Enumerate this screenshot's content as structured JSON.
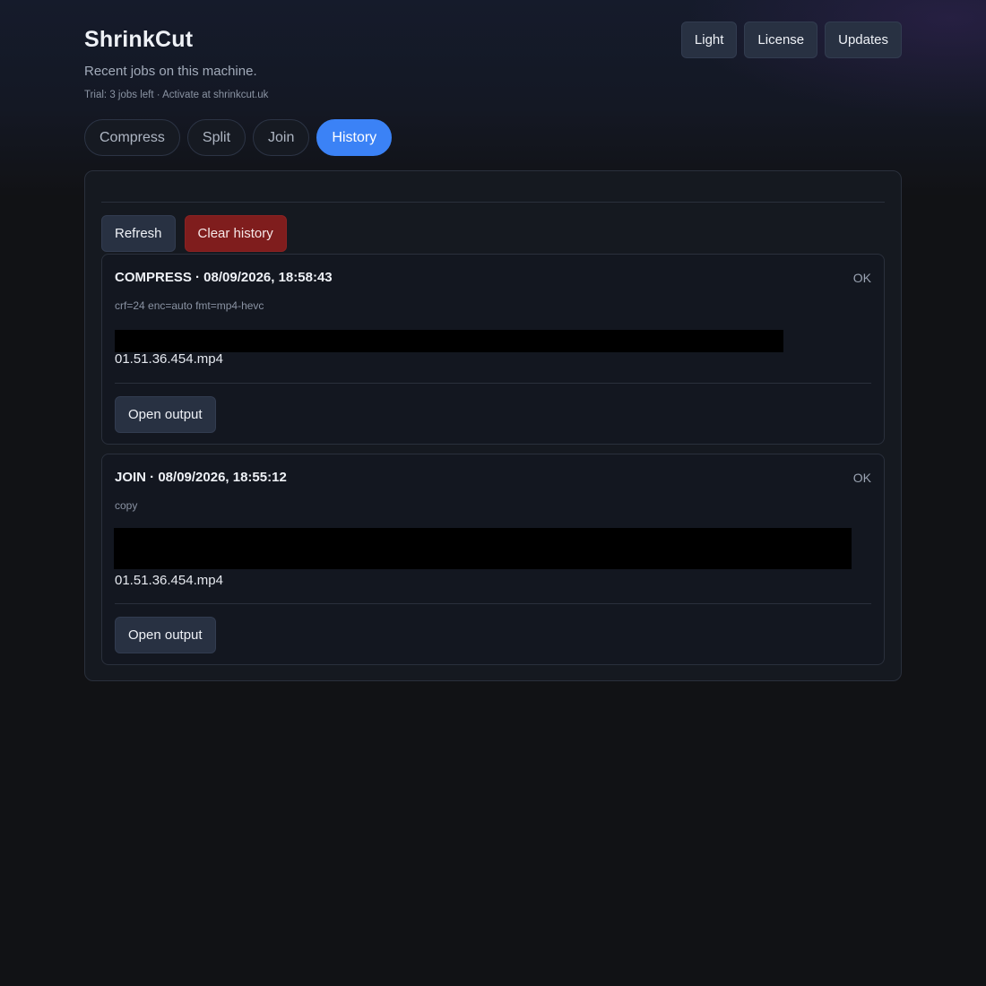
{
  "app": {
    "title": "ShrinkCut",
    "subtitle": "Recent jobs on this machine.",
    "trial": "Trial: 3 jobs left · Activate at shrinkcut.uk"
  },
  "top_actions": {
    "theme_label": "Light",
    "license_label": "License",
    "updates_label": "Updates"
  },
  "tabs": [
    {
      "label": "Compress",
      "active": false
    },
    {
      "label": "Split",
      "active": false
    },
    {
      "label": "Join",
      "active": false
    },
    {
      "label": "History",
      "active": true
    }
  ],
  "history": {
    "refresh_label": "Refresh",
    "clear_label": "Clear history",
    "jobs": [
      {
        "title": "COMPRESS · 08/09/2026, 18:58:43",
        "status": "OK",
        "params": "crf=24 enc=auto fmt=mp4-hevc",
        "file": "01.51.36.454.mp4",
        "open_label": "Open output"
      },
      {
        "title": "JOIN · 08/09/2026, 18:55:12",
        "status": "OK",
        "params": "copy",
        "file": "01.51.36.454.mp4",
        "open_label": "Open output"
      }
    ]
  },
  "colors": {
    "background": "#111215",
    "panel": "#151920",
    "accent": "#3b82f6",
    "danger": "#7f1d1d",
    "button": "#283142"
  }
}
